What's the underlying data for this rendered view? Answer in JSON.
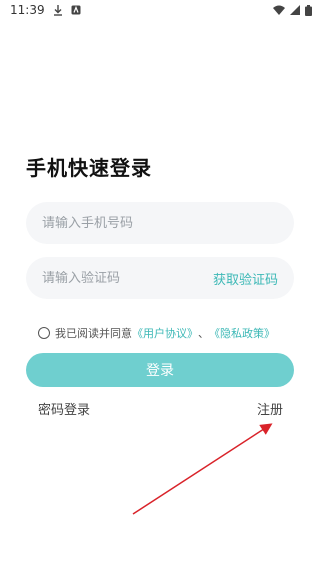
{
  "status_bar": {
    "time": "11:39",
    "icons": [
      "download-icon",
      "notification-app-icon",
      "wifi-icon",
      "signal-icon",
      "battery-icon"
    ]
  },
  "page": {
    "title": "手机快速登录"
  },
  "phone": {
    "placeholder": "请输入手机号码",
    "value": ""
  },
  "code": {
    "placeholder": "请输入验证码",
    "value": "",
    "get_code_label": "获取验证码"
  },
  "agreement": {
    "prefix": "我已阅读并同意",
    "user_agreement": "《用户协议》",
    "separator": "、",
    "privacy_policy": "《隐私政策》",
    "checked": false
  },
  "actions": {
    "login_label": "登录",
    "password_login_label": "密码登录",
    "register_label": "注册"
  },
  "colors": {
    "accent": "#3cb8b6",
    "button": "#6fcfcf",
    "input_bg": "#f5f6f8",
    "annotation": "#d9232a"
  }
}
